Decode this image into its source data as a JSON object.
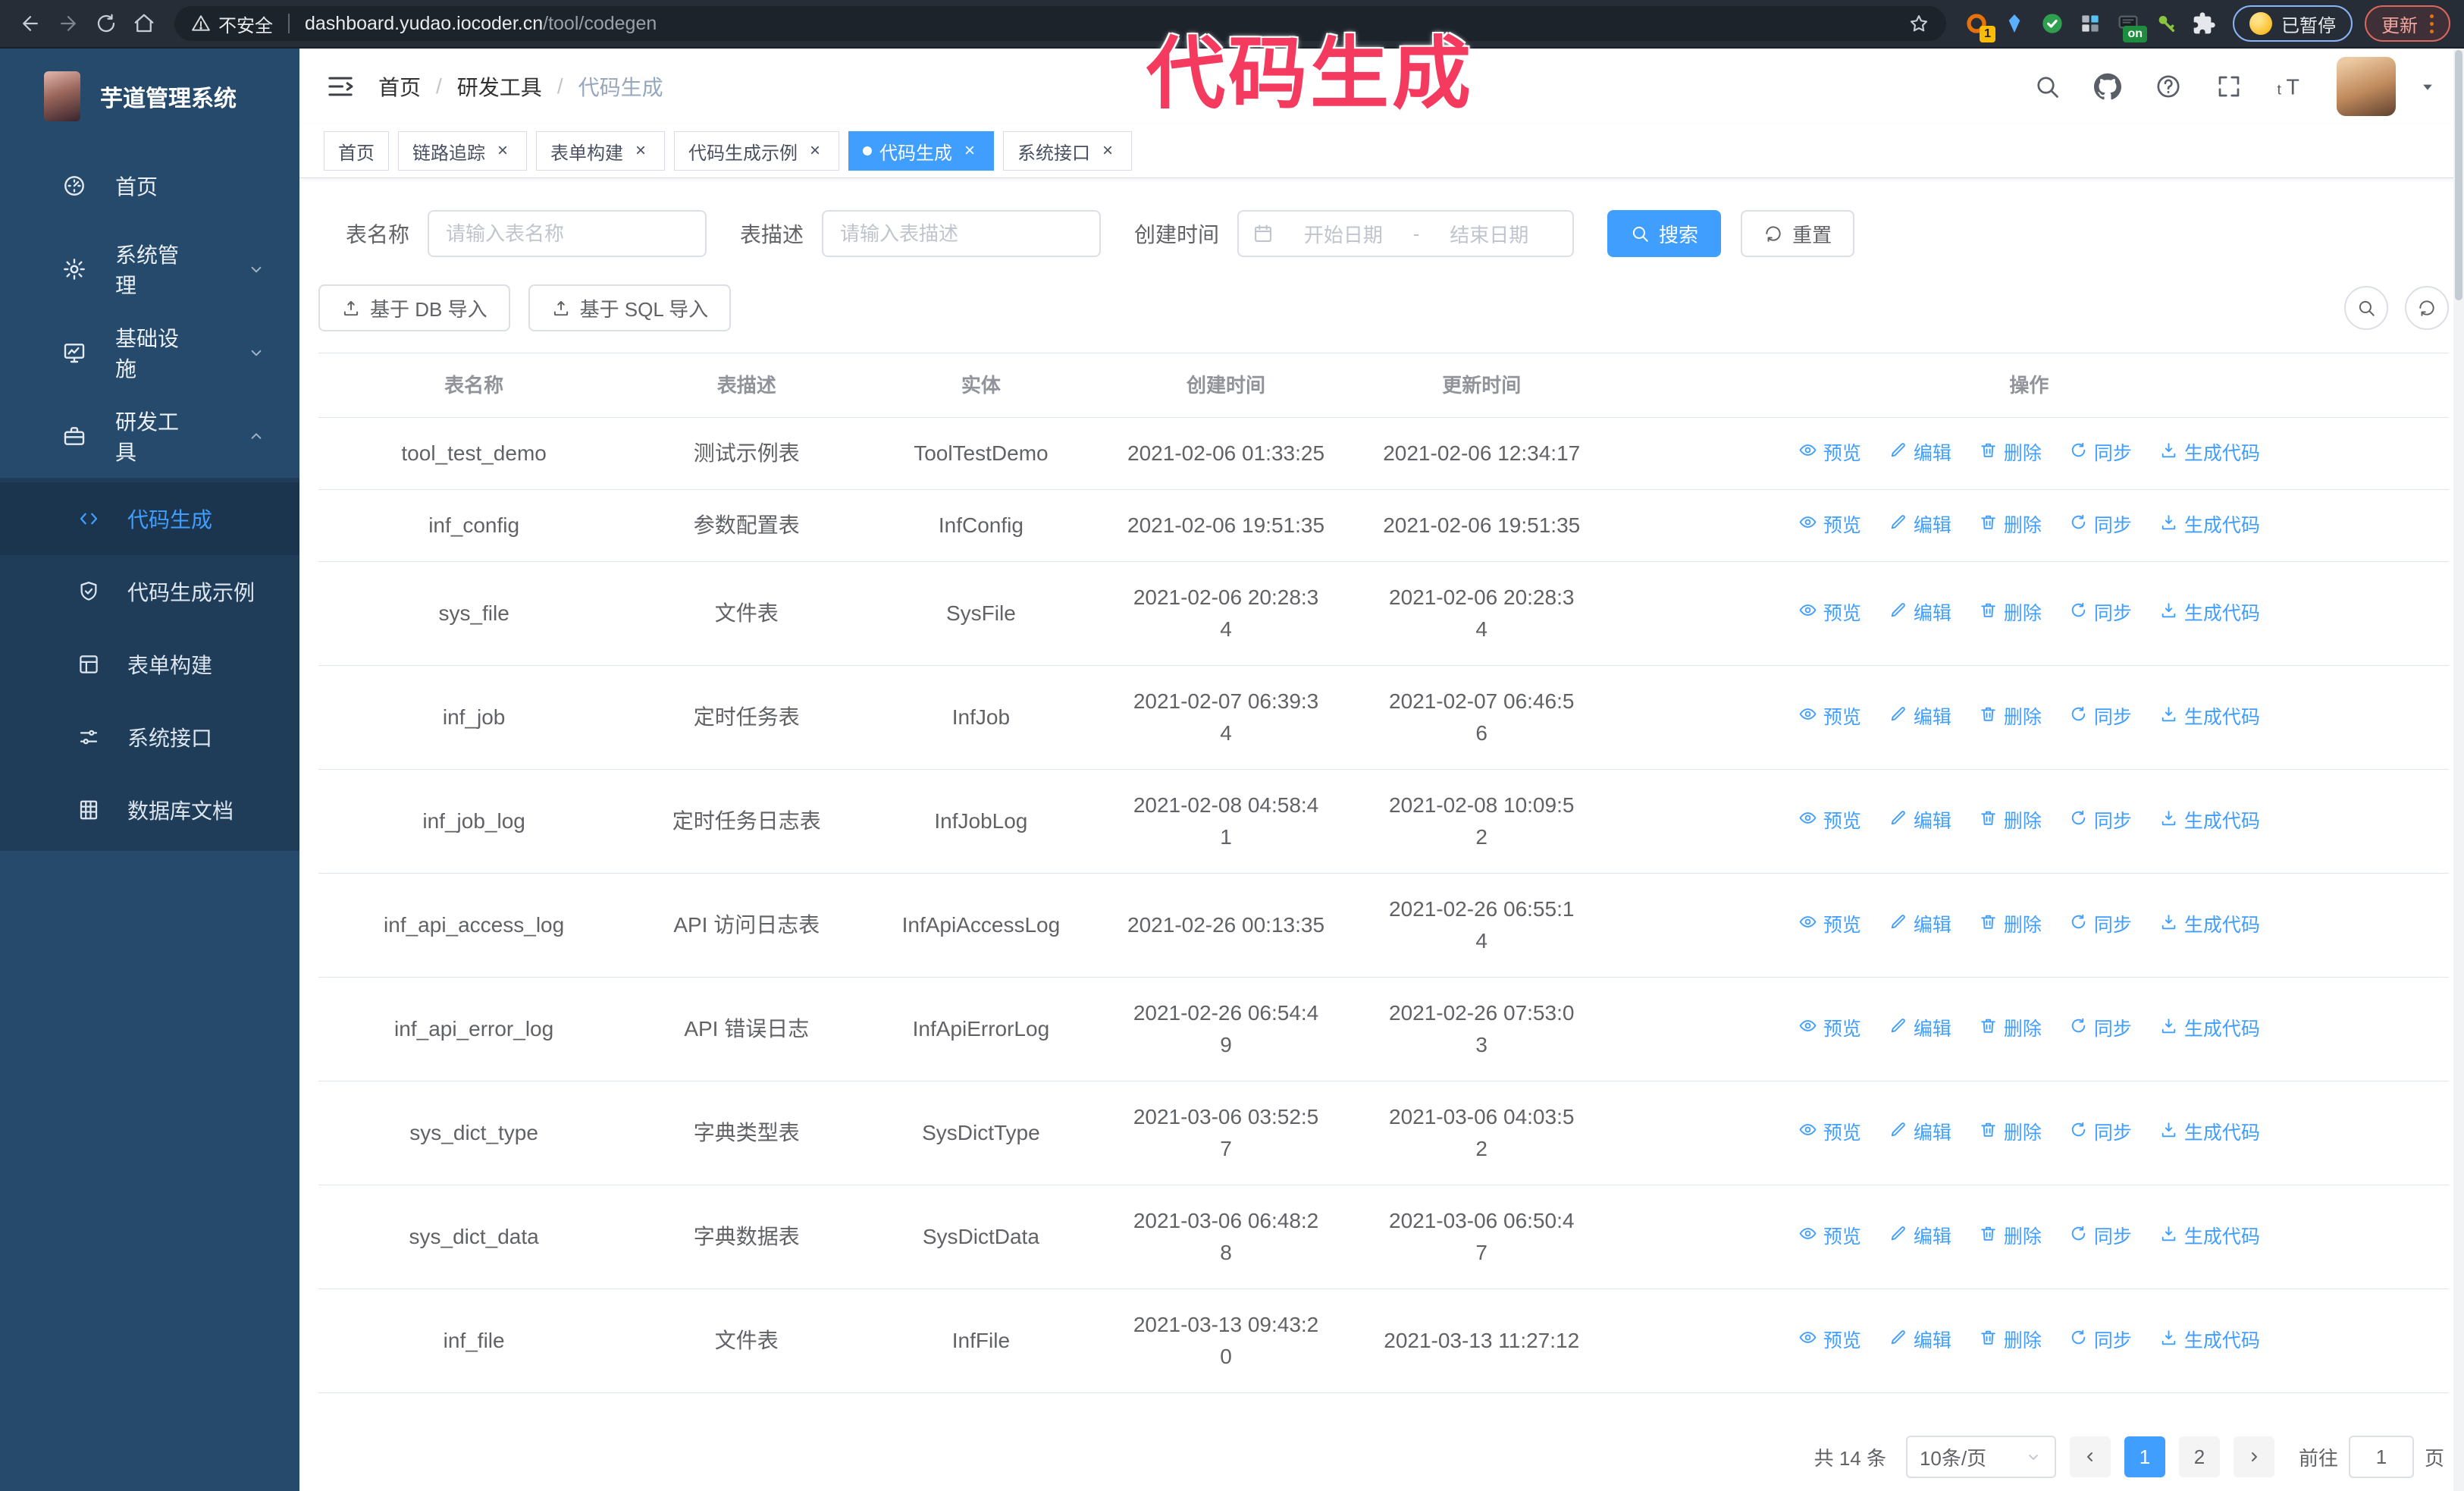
{
  "colors": {
    "accent": "#409eff",
    "sidebar_bg": "#264a6b",
    "submenu_bg": "#1f3c59",
    "annotation": "#f43a5e",
    "chrome_bg": "#262d36"
  },
  "browser": {
    "security_warning": "不安全",
    "url_host": "dashboard.yudao.iocoder.cn",
    "url_path": "/tool/codegen",
    "paused_label": "已暂停",
    "update_label": "更新",
    "extensions": [
      {
        "icon": "orange-ring-icon",
        "badge": "1"
      },
      {
        "icon": "blue-gem-icon"
      },
      {
        "icon": "green-check-icon"
      },
      {
        "icon": "grid-blue-icon"
      },
      {
        "icon": "dark-on-icon",
        "badge": "on"
      },
      {
        "icon": "green-key-icon"
      },
      {
        "icon": "puzzle-icon"
      }
    ]
  },
  "annotation": {
    "text": "代码生成"
  },
  "sidebar": {
    "title": "芋道管理系统",
    "items": [
      {
        "label": "首页",
        "icon": "dashboard-icon"
      },
      {
        "label": "系统管理",
        "icon": "gear-icon",
        "chevron": "down"
      },
      {
        "label": "基础设施",
        "icon": "monitor-icon",
        "chevron": "down"
      },
      {
        "label": "研发工具",
        "icon": "toolbox-icon",
        "chevron": "up"
      }
    ],
    "submenu": [
      {
        "label": "代码生成",
        "icon": "code-icon",
        "active": true
      },
      {
        "label": "代码生成示例",
        "icon": "shield-check-icon"
      },
      {
        "label": "表单构建",
        "icon": "form-icon"
      },
      {
        "label": "系统接口",
        "icon": "sliders-icon"
      },
      {
        "label": "数据库文档",
        "icon": "database-icon"
      }
    ]
  },
  "breadcrumb": [
    "首页",
    "研发工具",
    "代码生成"
  ],
  "tabs": [
    {
      "label": "首页",
      "closable": false
    },
    {
      "label": "链路追踪",
      "closable": true
    },
    {
      "label": "表单构建",
      "closable": true
    },
    {
      "label": "代码生成示例",
      "closable": true
    },
    {
      "label": "代码生成",
      "closable": true,
      "active": true
    },
    {
      "label": "系统接口",
      "closable": true
    }
  ],
  "search_form": {
    "table_name_label": "表名称",
    "table_name_placeholder": "请输入表名称",
    "table_desc_label": "表描述",
    "table_desc_placeholder": "请输入表描述",
    "create_time_label": "创建时间",
    "start_date_placeholder": "开始日期",
    "range_separator": "-",
    "end_date_placeholder": "结束日期",
    "search_button": "搜索",
    "reset_button": "重置"
  },
  "toolbar": {
    "import_db_button": "基于 DB 导入",
    "import_sql_button": "基于 SQL 导入"
  },
  "table": {
    "columns": [
      "表名称",
      "表描述",
      "实体",
      "创建时间",
      "更新时间",
      "操作"
    ],
    "actions": [
      {
        "label": "预览",
        "icon": "eye-icon"
      },
      {
        "label": "编辑",
        "icon": "edit-icon"
      },
      {
        "label": "删除",
        "icon": "delete-icon"
      },
      {
        "label": "同步",
        "icon": "sync-icon"
      },
      {
        "label": "生成代码",
        "icon": "download-icon"
      }
    ],
    "rows": [
      {
        "name": "tool_test_demo",
        "desc": "测试示例表",
        "entity": "ToolTestDemo",
        "create_time": "2021-02-06 01:33:25",
        "update_time": "2021-02-06 12:34:17"
      },
      {
        "name": "inf_config",
        "desc": "参数配置表",
        "entity": "InfConfig",
        "create_time": "2021-02-06 19:51:35",
        "update_time": "2021-02-06 19:51:35"
      },
      {
        "name": "sys_file",
        "desc": "文件表",
        "entity": "SysFile",
        "create_time": "2021-02-06 20:28:3\n4",
        "update_time": "2021-02-06 20:28:3\n4"
      },
      {
        "name": "inf_job",
        "desc": "定时任务表",
        "entity": "InfJob",
        "create_time": "2021-02-07 06:39:3\n4",
        "update_time": "2021-02-07 06:46:5\n6"
      },
      {
        "name": "inf_job_log",
        "desc": "定时任务日志表",
        "entity": "InfJobLog",
        "create_time": "2021-02-08 04:58:4\n1",
        "update_time": "2021-02-08 10:09:5\n2"
      },
      {
        "name": "inf_api_access_log",
        "desc": "API 访问日志表",
        "entity": "InfApiAccessLog",
        "create_time": "2021-02-26 00:13:35",
        "update_time": "2021-02-26 06:55:1\n4"
      },
      {
        "name": "inf_api_error_log",
        "desc": "API 错误日志",
        "entity": "InfApiErrorLog",
        "create_time": "2021-02-26 06:54:4\n9",
        "update_time": "2021-02-26 07:53:0\n3"
      },
      {
        "name": "sys_dict_type",
        "desc": "字典类型表",
        "entity": "SysDictType",
        "create_time": "2021-03-06 03:52:5\n7",
        "update_time": "2021-03-06 04:03:5\n2"
      },
      {
        "name": "sys_dict_data",
        "desc": "字典数据表",
        "entity": "SysDictData",
        "create_time": "2021-03-06 06:48:2\n8",
        "update_time": "2021-03-06 06:50:4\n7"
      },
      {
        "name": "inf_file",
        "desc": "文件表",
        "entity": "InfFile",
        "create_time": "2021-03-13 09:43:2\n0",
        "update_time": "2021-03-13 11:27:12"
      }
    ]
  },
  "pagination": {
    "total_text": "共 14 条",
    "page_size": "10条/页",
    "pages": [
      "1",
      "2"
    ],
    "active_page": "1",
    "goto_label": "前往",
    "goto_value": "1",
    "goto_suffix": "页"
  }
}
